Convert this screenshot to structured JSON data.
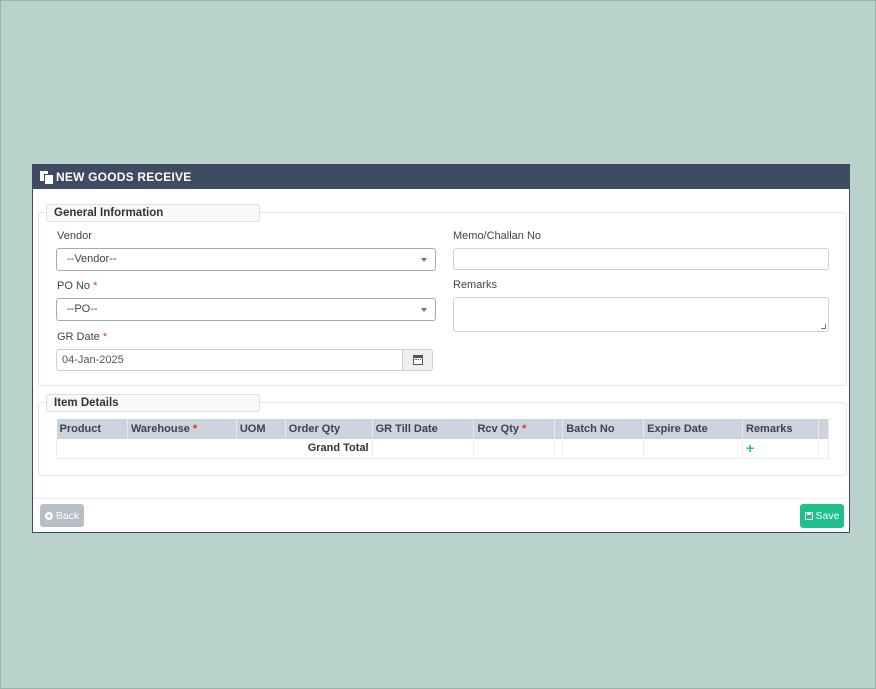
{
  "header": {
    "title": "NEW GOODS RECEIVE",
    "icon": "copy-icon"
  },
  "general": {
    "legend": "General Information",
    "vendor_label": "Vendor",
    "vendor_value": "--Vendor--",
    "po_label": "PO No",
    "po_value": "--PO--",
    "gr_date_label": "GR Date",
    "gr_date_value": "04-Jan-2025",
    "memo_label": "Memo/Challan No",
    "memo_value": "",
    "remarks_label": "Remarks",
    "required_mark": "*"
  },
  "items": {
    "legend": "Item Details",
    "columns": [
      "Product",
      "Warehouse",
      "UOM",
      "Order Qty",
      "GR Till Date",
      "Rcv Qty",
      "",
      "Batch No",
      "Expire Date",
      "Remarks"
    ],
    "grand_total_label": "Grand Total",
    "add_icon": "plus-icon",
    "add_symbol": "+"
  },
  "footer": {
    "back_label": "Back",
    "save_label": "Save"
  },
  "colors": {
    "header_bg": "#3f4a63",
    "page_bg": "#b9d3cc",
    "save_btn": "#1fc08d",
    "back_btn": "#b8bec6"
  }
}
